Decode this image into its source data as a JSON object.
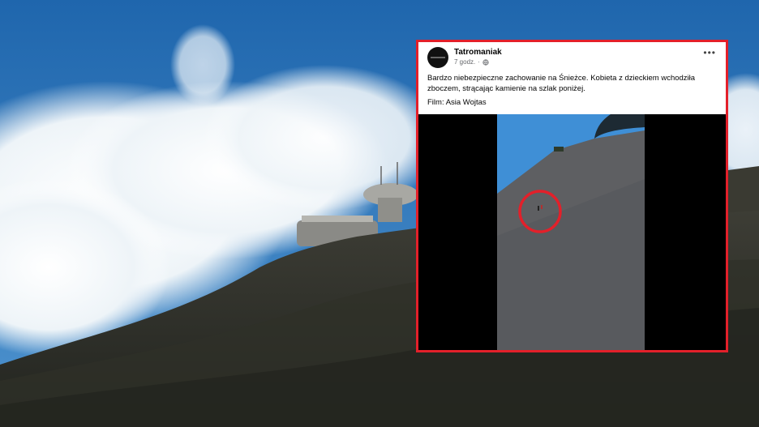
{
  "post": {
    "author": "Tatromaniak",
    "time": "7 godz.",
    "text": "Bardzo niebezpieczne zachowanie na Śnieżce. Kobieta z dzieckiem wchodziła zboczem, strącając kamienie na szlak poniżej.",
    "credit": "Film: Asia Wojtas",
    "more_icon": "more-options-icon",
    "privacy_icon": "globe-icon"
  },
  "colors": {
    "frame": "#e3202a",
    "sky": "#2d74b8",
    "highlight_circle": "#e3202a"
  }
}
